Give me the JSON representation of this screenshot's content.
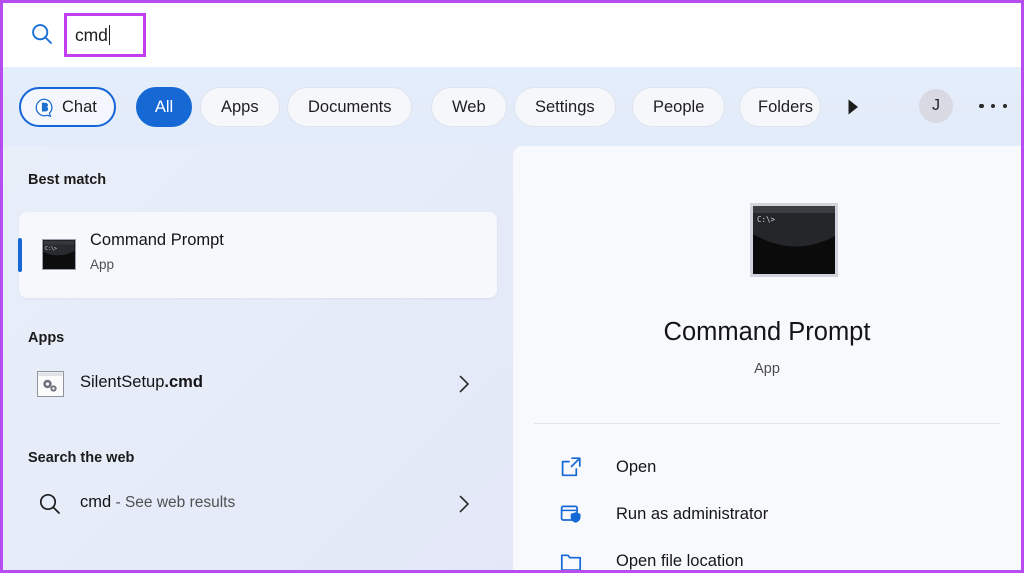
{
  "search": {
    "icon": "search-icon",
    "value": "cmd",
    "annotation_color": "#c13ff0"
  },
  "filters": {
    "chips": [
      {
        "label": "Chat",
        "icon": "copilot-icon",
        "state": "outlined"
      },
      {
        "label": "All",
        "state": "selected"
      },
      {
        "label": "Apps",
        "state": "normal"
      },
      {
        "label": "Documents",
        "state": "normal"
      },
      {
        "label": "Web",
        "state": "normal"
      },
      {
        "label": "Settings",
        "state": "normal"
      },
      {
        "label": "People",
        "state": "normal"
      },
      {
        "label": "Folders",
        "state": "clipped"
      }
    ],
    "scroll_arrow": "chevron-right-arrow",
    "avatar_initial": "J",
    "more_label": "more-options",
    "accent_color": "#1669d4"
  },
  "results": {
    "sections": {
      "best_match": "Best match",
      "apps": "Apps",
      "web": "Search the web"
    },
    "best_match": {
      "title": "Command Prompt",
      "subtitle": "App",
      "icon": "console-icon",
      "selected": true
    },
    "app_result": {
      "name_plain": "SilentSetup",
      "name_bold": ".cmd",
      "icon": "script-gears-icon"
    },
    "web_result": {
      "query": "cmd",
      "suffix": " - See web results",
      "icon": "search-icon"
    }
  },
  "preview": {
    "icon": "console-icon-large",
    "title": "Command Prompt",
    "subtitle": "App",
    "actions": [
      {
        "label": "Open",
        "icon": "open-external-icon"
      },
      {
        "label": "Run as administrator",
        "icon": "shield-window-icon"
      },
      {
        "label": "Open file location",
        "icon": "folder-icon"
      }
    ],
    "icon_color": "#1668d6"
  }
}
